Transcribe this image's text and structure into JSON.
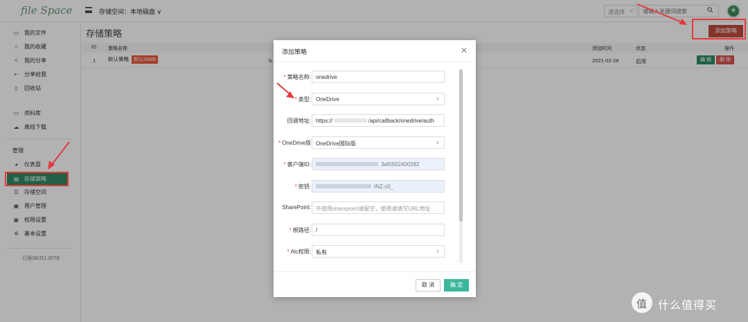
{
  "app": {
    "logo": "file Space",
    "storage_label": "存储空间：本地磁盘 ∨",
    "select_placeholder": "请选择",
    "search_placeholder": "请输入关键词搜索"
  },
  "sidebar": {
    "items": [
      {
        "label": "我的文件",
        "icon": "folder-icon"
      },
      {
        "label": "我的收藏",
        "icon": "star-icon"
      },
      {
        "label": "我的分享",
        "icon": "share-icon"
      },
      {
        "label": "分享给我",
        "icon": "shared-with-me-icon"
      },
      {
        "label": "回收站",
        "icon": "trash-icon"
      },
      {
        "label": "资料库",
        "icon": "library-icon"
      },
      {
        "label": "离线下载",
        "icon": "cloud-download-icon"
      }
    ],
    "admin_heading": "管理",
    "admin_items": [
      {
        "label": "仪表盘",
        "icon": "dashboard-icon"
      },
      {
        "label": "存储策略",
        "icon": "storage-policy-icon"
      },
      {
        "label": "存储空间",
        "icon": "storage-space-icon"
      },
      {
        "label": "用户管理",
        "icon": "users-icon"
      },
      {
        "label": "权限设置",
        "icon": "permission-icon"
      },
      {
        "label": "基本设置",
        "icon": "settings-icon"
      }
    ],
    "usage": "已用0B/共1.00TB"
  },
  "page": {
    "title": "存储策略",
    "add_button": "添加策略",
    "columns": {
      "id": "ID",
      "name": "策略名称",
      "created": "添加时间",
      "status": "状态",
      "actions": "操作"
    },
    "rows": [
      {
        "id": "1",
        "name": "默认策略",
        "badge": "默认50MB",
        "type_partial": "lc",
        "created": "2021-02-28",
        "status": "启用",
        "edit": "编 辑",
        "delete": "删 除"
      }
    ]
  },
  "modal": {
    "title": "添加策略",
    "fields": {
      "name": {
        "label": "策略名称:",
        "value": "onedrive",
        "required": true
      },
      "type": {
        "label": "类型:",
        "value": "OneDrive",
        "required": true
      },
      "callback": {
        "label": "回调地址:",
        "value_prefix": "https://",
        "value_suffix": "/api/callback/onedrive/auth",
        "required": false
      },
      "region": {
        "label": "OneDrive版",
        "value": "OneDrive国际版",
        "required": true
      },
      "client_id": {
        "label": "客户端ID:",
        "value": "3ef0502400282",
        "required": true
      },
      "secret": {
        "label": "密钥:",
        "value": "tNZ.c0_",
        "required": true
      },
      "sharepoint": {
        "label": "SharePoint:",
        "placeholder": "不使用sharepoint请留空，使用请填写URL地址",
        "required": false
      },
      "root": {
        "label": "根路径:",
        "value": "/",
        "required": true
      },
      "acl": {
        "label": "Alc权限:",
        "value": "私有",
        "required": true
      }
    },
    "cancel": "取 消",
    "ok": "确 定"
  },
  "watermark": {
    "text": "什么值得买"
  }
}
